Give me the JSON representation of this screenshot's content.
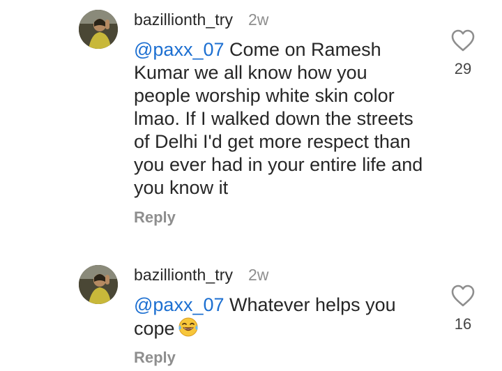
{
  "comments": [
    {
      "username": "bazillionth_try",
      "timestamp": "2w",
      "mention": "@paxx_07",
      "text": " Come on Ramesh Kumar we all know how you people worship white skin color lmao. If I walked down the streets of Delhi I'd get more respect than you ever had in your entire life and you know it",
      "reply_label": "Reply",
      "like_count": "29",
      "like_icon": "heart-outline-icon"
    },
    {
      "username": "bazillionth_try",
      "timestamp": "2w",
      "mention": "@paxx_07",
      "text": " Whatever helps you cope",
      "emoji": "😂",
      "reply_label": "Reply",
      "like_count": "16",
      "like_icon": "heart-outline-icon"
    }
  ],
  "colors": {
    "mention": "#1c6fd1",
    "secondary_text": "#8e8e8e",
    "primary_text": "#262626"
  }
}
